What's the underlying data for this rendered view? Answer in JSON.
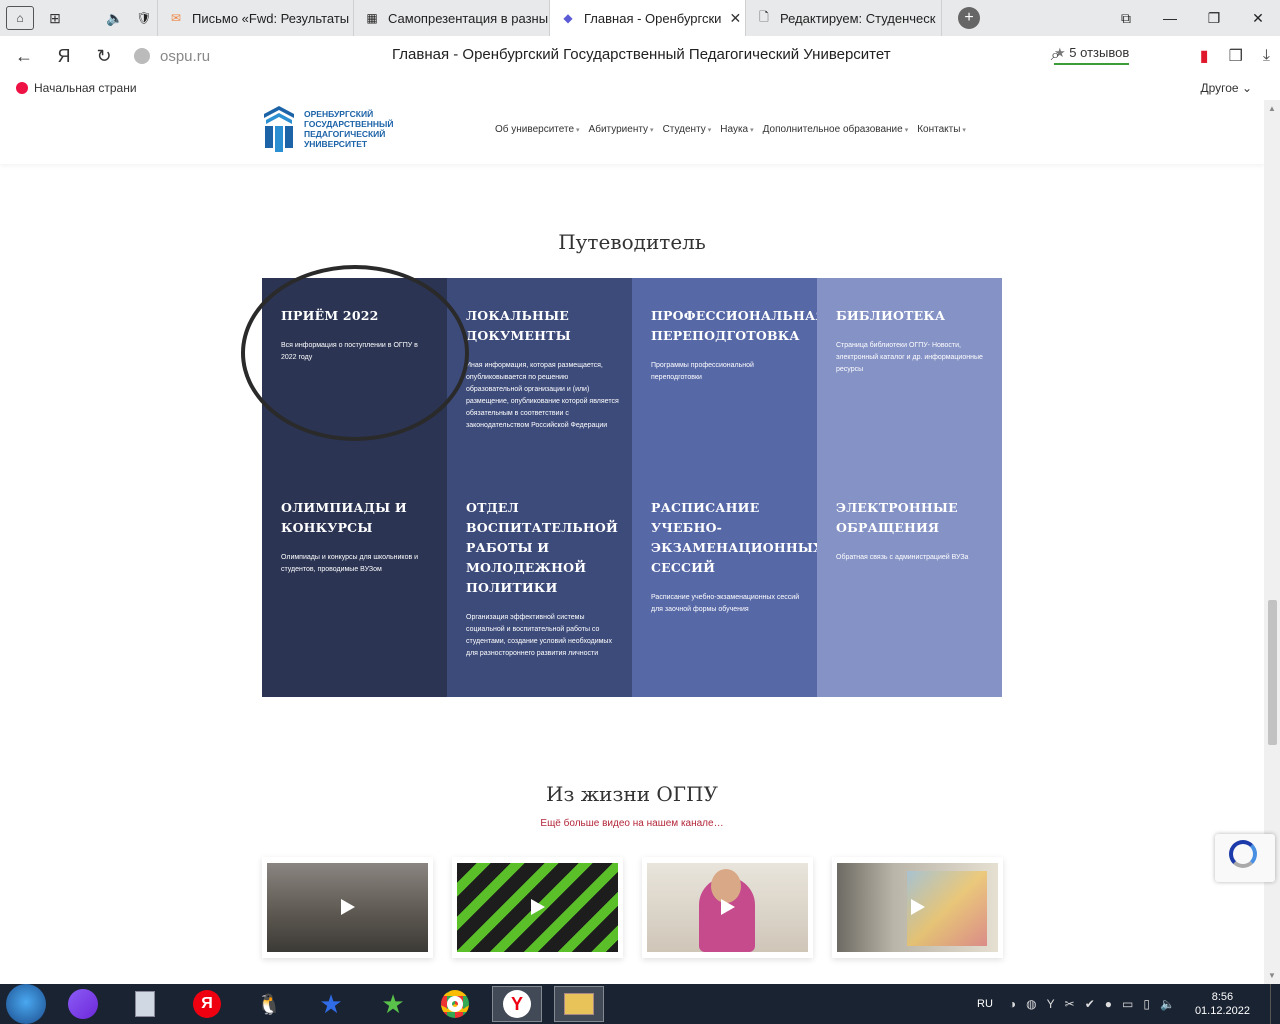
{
  "browser": {
    "tabs": [
      {
        "label": "Письмо «Fwd: Результаты"
      },
      {
        "label": "Самопрезентация в разны"
      },
      {
        "label": "Главная - Оренбургски",
        "active": true
      },
      {
        "label": "Редактируем: Студенческ"
      }
    ],
    "domain": "ospu.ru",
    "page_title": "Главная - Оренбургский Государственный Педагогический Университет",
    "reviews": "5 отзывов",
    "bookmark_home": "Начальная страни",
    "bookmark_other": "Другое"
  },
  "site": {
    "logo_text": [
      "ОРЕНБУРГСКИЙ",
      "ГОСУДАРСТВЕННЫЙ",
      "ПЕДАГОГИЧЕСКИЙ",
      "УНИВЕРСИТЕТ"
    ],
    "nav": [
      "Об университете",
      "Абитуриенту",
      "Студенту",
      "Наука",
      "Дополнительное образование",
      "Контакты"
    ],
    "guide_title": "Путеводитель",
    "guide": [
      {
        "title": "ПРИЁМ 2022",
        "text": "Вся информация о поступлении в ОГПУ в 2022 году"
      },
      {
        "title": "ЛОКАЛЬНЫЕ ДОКУМЕНТЫ",
        "text": "Иная информация, которая размещается, опубликовывается по решению образовательной организации и (или) размещение, опубликование которой является обязательным в соответствии с законодательством Российской Федерации"
      },
      {
        "title": "ПРОФЕССИОНАЛЬНАЯ ПЕРЕПОДГОТОВКА",
        "text": "Программы профессиональной переподготовки"
      },
      {
        "title": "БИБЛИОТЕКА",
        "text": "Страница библиотеки ОГПУ- Новости, электронный каталог и др. информационные ресурсы"
      },
      {
        "title": "ОЛИМПИАДЫ И КОНКУРСЫ",
        "text": "Олимпиады и конкурсы для школьников и студентов, проводимые ВУЗом"
      },
      {
        "title": "ОТДЕЛ ВОСПИТАТЕЛЬНОЙ РАБОТЫ И МОЛОДЕЖНОЙ ПОЛИТИКИ",
        "text": "Организация эффективной системы социальной и воспитательной работы со студентами, создание условий необходимых для разностороннего развития личности"
      },
      {
        "title": "РАСПИСАНИЕ УЧЕБНО-ЭКЗАМЕНАЦИОННЫХ СЕССИЙ",
        "text": "Расписание учебно-экзаменационных сессий для заочной формы обучения"
      },
      {
        "title": "ЭЛЕКТРОННЫЕ ОБРАЩЕНИЯ",
        "text": "Обратная связь с администрацией ВУЗа"
      }
    ],
    "life_title": "Из жизни ОГПУ",
    "life_link": "Ещё больше видео на нашем канале…"
  },
  "taskbar": {
    "lang": "RU",
    "time": "8:56",
    "date": "01.12.2022"
  }
}
